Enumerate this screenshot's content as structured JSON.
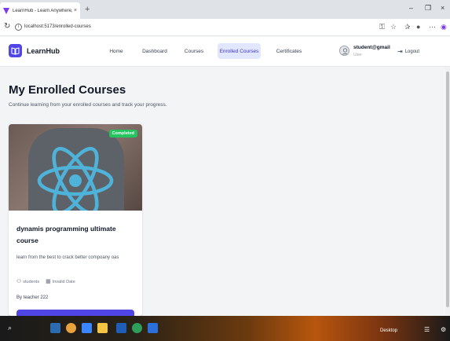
{
  "browser": {
    "tab_title": "LearnHub - Learn Anywhere, Any",
    "tab_close": "×",
    "new_tab": "+",
    "window_min": "–",
    "window_max": "❐",
    "window_close": "×",
    "url": "localhost:5173/enrolled-courses"
  },
  "header": {
    "brand": "LearnHub",
    "nav": [
      {
        "label": "Home"
      },
      {
        "label": "Dashboard"
      },
      {
        "label": "Courses"
      },
      {
        "label": "Enrolled Courses"
      },
      {
        "label": "Certificates"
      }
    ],
    "active_nav": "Enrolled Courses",
    "user_name": "student@gmail",
    "user_role": "User",
    "logout_label": "Logout"
  },
  "page": {
    "title": "My Enrolled Courses",
    "subtitle": "Continue learning from your enrolled courses and track your progress."
  },
  "courses": [
    {
      "status": "Completed",
      "title": "dynamis programming ultimate course",
      "description": "learn from the best to crack better compoany oas",
      "students_label": "students",
      "date_label": "Invalid Date",
      "teacher": "By teacher 222"
    }
  ],
  "taskbar": {
    "search_label": "Search",
    "desktop_label": "Desktop"
  },
  "colors": {
    "accent": "#4f46e5",
    "active_nav_bg": "#e0e7ff",
    "badge_completed": "#22c55e",
    "react_logo": "#4fb3d9"
  }
}
